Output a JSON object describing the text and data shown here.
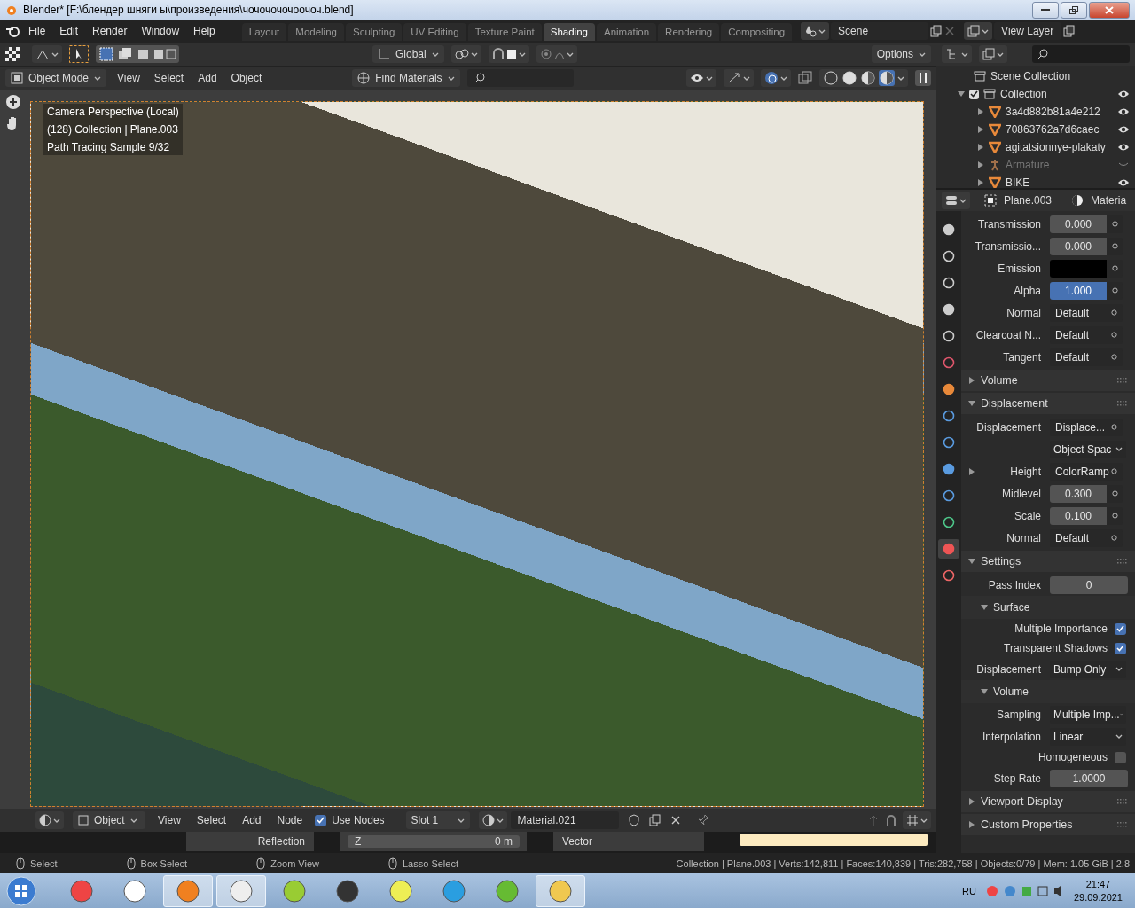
{
  "title_bar": {
    "title": "Blender* [F:\\блендер шняги ы\\произведения\\чочочочочоочоч.blend]"
  },
  "menu": [
    "File",
    "Edit",
    "Render",
    "Window",
    "Help"
  ],
  "workspaces": [
    {
      "label": "Layout",
      "selected": false
    },
    {
      "label": "Modeling",
      "selected": false
    },
    {
      "label": "Sculpting",
      "selected": false
    },
    {
      "label": "UV Editing",
      "selected": false
    },
    {
      "label": "Texture Paint",
      "selected": false
    },
    {
      "label": "Shading",
      "selected": true
    },
    {
      "label": "Animation",
      "selected": false
    },
    {
      "label": "Rendering",
      "selected": false
    },
    {
      "label": "Compositing",
      "selected": false
    }
  ],
  "scene": "Scene",
  "view_layer": "View Layer",
  "viewport": {
    "transform": "Global",
    "options": "Options",
    "mode": "Object Mode",
    "menus": [
      "View",
      "Select",
      "Add",
      "Object"
    ],
    "find": "Find Materials",
    "shading_modes": [
      {
        "selected": false
      },
      {
        "selected": false
      },
      {
        "selected": false
      },
      {
        "selected": true
      }
    ],
    "overlay_lines": [
      "Camera Perspective (Local)",
      "(128) Collection | Plane.003",
      "Path Tracing Sample 9/32"
    ]
  },
  "outliner": {
    "title": "Scene Collection",
    "collection": {
      "label": "Collection",
      "checked": true,
      "children": [
        {
          "label": "3a4d882b81a4e212",
          "hidden": false
        },
        {
          "label": "70863762a7d6caec",
          "hidden": false
        },
        {
          "label": "agitatsionnye-plakaty",
          "hidden": false
        },
        {
          "label": "Armature",
          "hidden": true
        },
        {
          "label": "BIKE",
          "hidden": false
        }
      ]
    }
  },
  "properties": {
    "object": "Plane.003",
    "context": "Materia",
    "tabs": [
      {
        "selected": false
      },
      {
        "selected": false
      },
      {
        "selected": false
      },
      {
        "selected": false
      },
      {
        "selected": false
      },
      {
        "selected": false
      },
      {
        "selected": false
      },
      {
        "selected": false
      },
      {
        "selected": false
      },
      {
        "selected": false
      },
      {
        "selected": false
      },
      {
        "selected": false
      },
      {
        "selected": true
      },
      {
        "selected": false
      }
    ],
    "rows": [
      {
        "kind": "value",
        "label": "Transmission",
        "value": "0.000",
        "highlighted": false
      },
      {
        "kind": "value",
        "label": "Transmissio...",
        "value": "0.000",
        "highlighted": false
      },
      {
        "kind": "color",
        "label": "Emission",
        "color": "#000000"
      },
      {
        "kind": "value",
        "label": "Alpha",
        "value": "1.000",
        "highlighted": true
      },
      {
        "kind": "link",
        "label": "Normal",
        "value": "Default"
      },
      {
        "kind": "link",
        "label": "Clearcoat N...",
        "value": "Default"
      },
      {
        "kind": "link",
        "label": "Tangent",
        "value": "Default"
      },
      {
        "kind": "panel",
        "label": "Volume",
        "expanded": false
      },
      {
        "kind": "panel",
        "label": "Displacement",
        "expanded": true
      },
      {
        "kind": "link",
        "label": "Displacement",
        "value": "Displace..."
      },
      {
        "kind": "dropdown",
        "value": "Object Spac"
      },
      {
        "kind": "node_link",
        "label": "Height",
        "value": "ColorRamp"
      },
      {
        "kind": "value",
        "label": "Midlevel",
        "value": "0.300",
        "highlighted": false
      },
      {
        "kind": "value",
        "label": "Scale",
        "value": "0.100",
        "highlighted": false
      },
      {
        "kind": "link",
        "label": "Normal",
        "value": "Default"
      },
      {
        "kind": "panel",
        "label": "Settings",
        "expanded": true
      },
      {
        "kind": "number",
        "label": "Pass Index",
        "value": "0"
      },
      {
        "kind": "subpanel",
        "label": "Surface",
        "expanded": true
      },
      {
        "kind": "checkbox",
        "label": "Multiple Importance",
        "checked": true
      },
      {
        "kind": "checkbox",
        "label": "Transparent Shadows",
        "checked": true
      },
      {
        "kind": "dropdown",
        "label": "Displacement",
        "value": "Bump Only"
      },
      {
        "kind": "subpanel",
        "label": "Volume",
        "expanded": true
      },
      {
        "kind": "dropdown",
        "label": "Sampling",
        "value": "Multiple Imp..."
      },
      {
        "kind": "dropdown",
        "label": "Interpolation",
        "value": "Linear"
      },
      {
        "kind": "checkbox",
        "label": "Homogeneous",
        "checked": false
      },
      {
        "kind": "number",
        "label": "Step Rate",
        "value": "1.0000"
      },
      {
        "kind": "panel",
        "label": "Viewport Display",
        "expanded": false
      },
      {
        "kind": "panel",
        "label": "Custom Properties",
        "expanded": false
      }
    ]
  },
  "node_editor": {
    "object": "Object",
    "menus": [
      "View",
      "Select",
      "Add",
      "Node"
    ],
    "use_nodes": {
      "label": "Use Nodes",
      "checked": true
    },
    "slot": "Slot 1",
    "material": "Material.021",
    "node_socket_label": "Reflection",
    "field_label": "Z",
    "field_value": "0 m",
    "output_label": "Vector"
  },
  "status_bar": {
    "hints": [
      "Select",
      "Box Select",
      "Zoom View",
      "Lasso Select"
    ],
    "stats": "Collection | Plane.003 | Verts:142,811 | Faces:140,839 | Tris:282,758 | Objects:0/79 | Mem: 1.05 GiB | 2.8"
  },
  "taskbar": {
    "apps": [
      {
        "running": false
      },
      {
        "running": false
      },
      {
        "running": true
      },
      {
        "running": true
      },
      {
        "running": false
      },
      {
        "running": false
      },
      {
        "running": false
      },
      {
        "running": false
      },
      {
        "running": false
      },
      {
        "running": true
      }
    ],
    "language": "RU",
    "time": "21:47",
    "date": "29.09.2021"
  }
}
